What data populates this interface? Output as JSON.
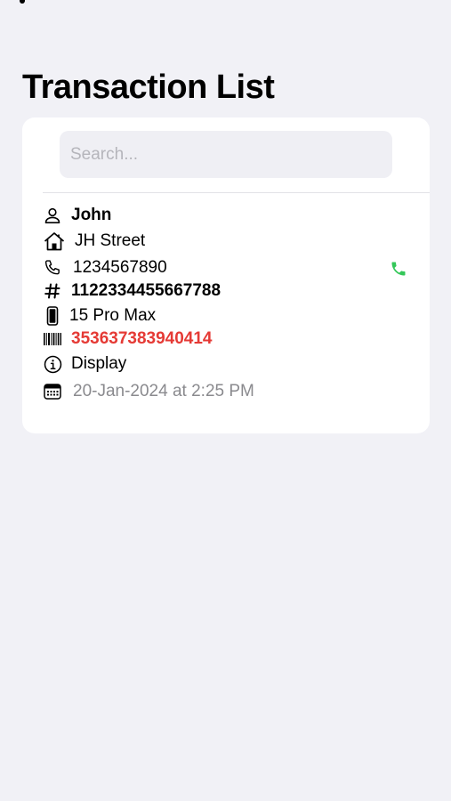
{
  "page": {
    "title": "Transaction List"
  },
  "search": {
    "placeholder": "Search...",
    "value": ""
  },
  "transaction": {
    "name": "John",
    "street": "JH Street",
    "phone": "1234567890",
    "number": "1122334455667788",
    "device": "15 Pro Max",
    "imei": "353637383940414",
    "status": "Display",
    "date": "20-Jan-2024 at 2:25 PM"
  },
  "colors": {
    "background": "#f1f1f6",
    "card": "#ffffff",
    "imei_red": "#e53a35",
    "call_green": "#34c759",
    "date_gray": "#8a8a8e"
  },
  "icons": {
    "name": "person-icon",
    "street": "house-icon",
    "phone": "phone-icon",
    "number": "hash-icon",
    "device": "iphone-icon",
    "imei": "barcode-icon",
    "status": "info-icon",
    "date": "calendar-icon",
    "call": "call-icon"
  }
}
